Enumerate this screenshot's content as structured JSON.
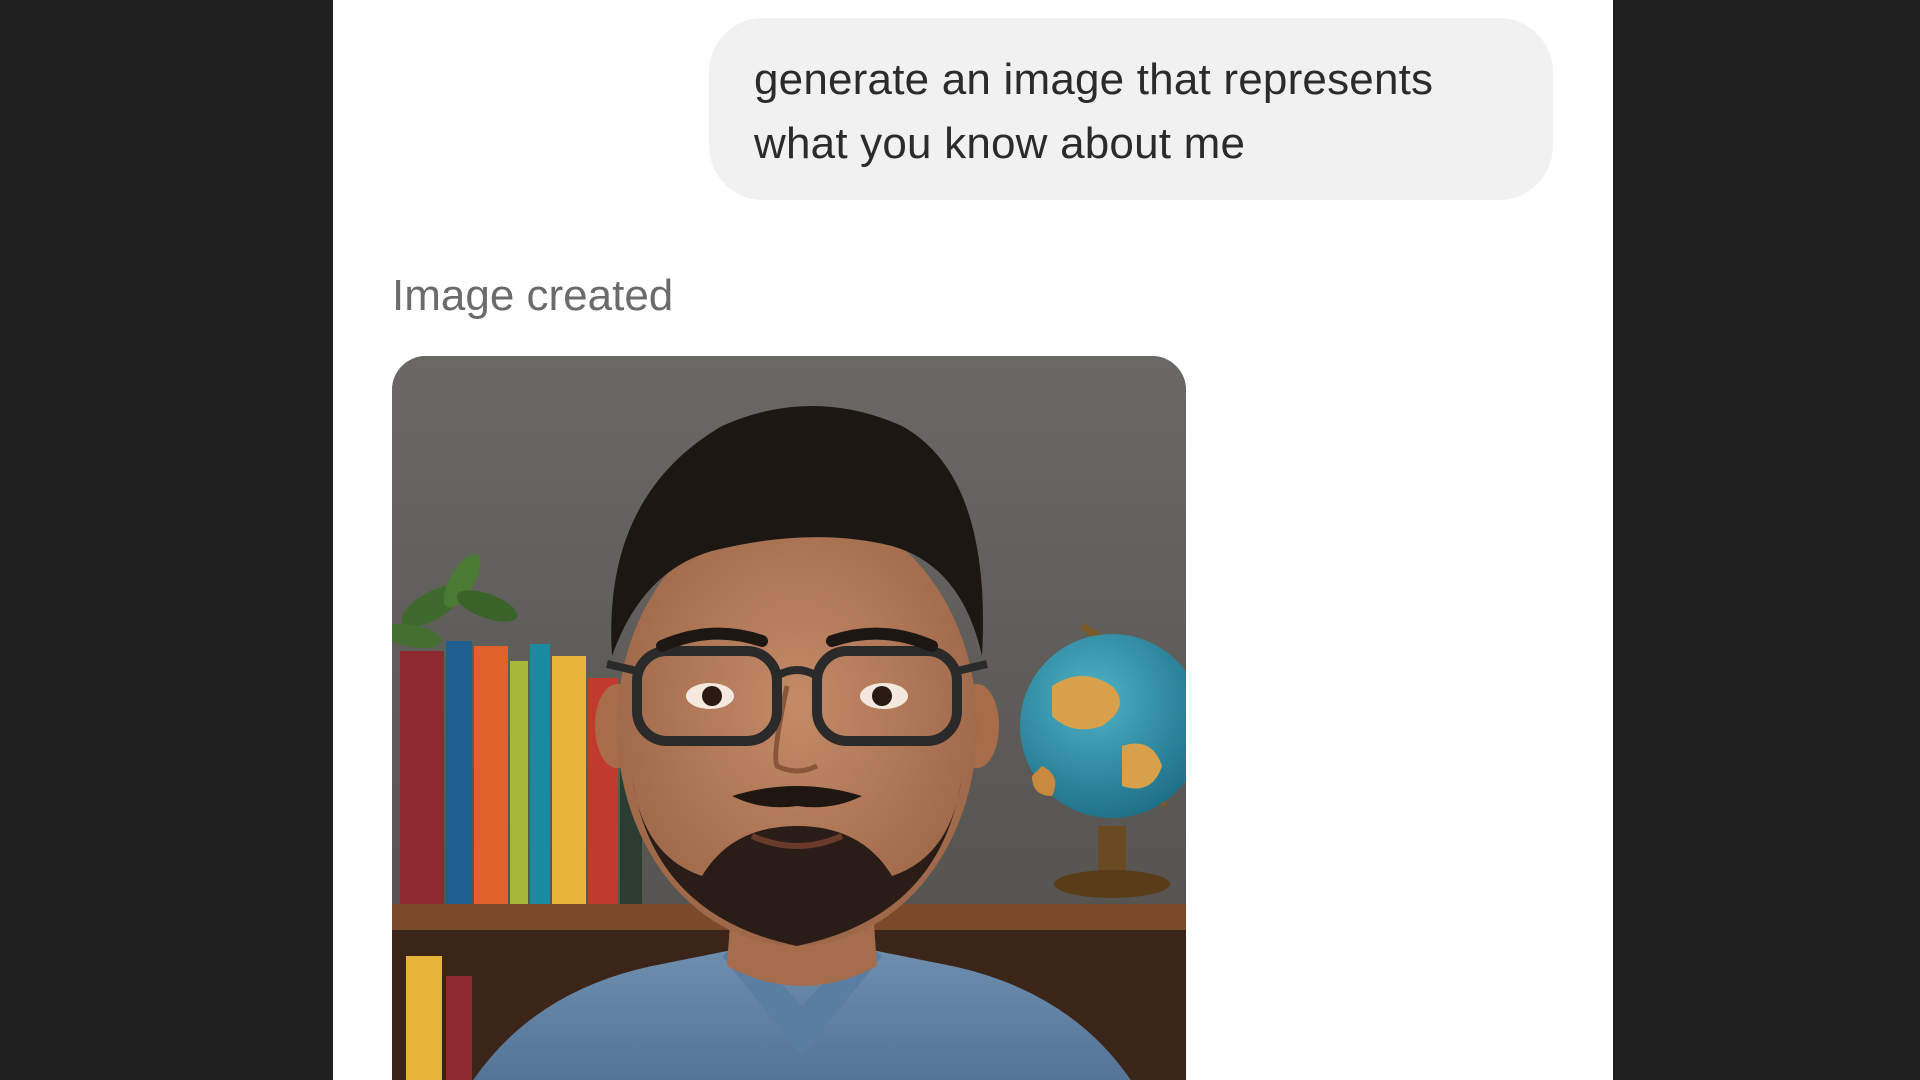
{
  "conversation": {
    "user_message": {
      "line1": "generate an image that represents",
      "line2": "what you know about me"
    },
    "assistant": {
      "status_label": "Image created",
      "image_subject": "portrait-photo"
    }
  },
  "theme": {
    "backdrop": "#1f1f1f",
    "panel": "#ffffff",
    "bubble": "#f1f1f1",
    "text": "#2b2b2b",
    "muted_text": "#6b6b6b"
  }
}
